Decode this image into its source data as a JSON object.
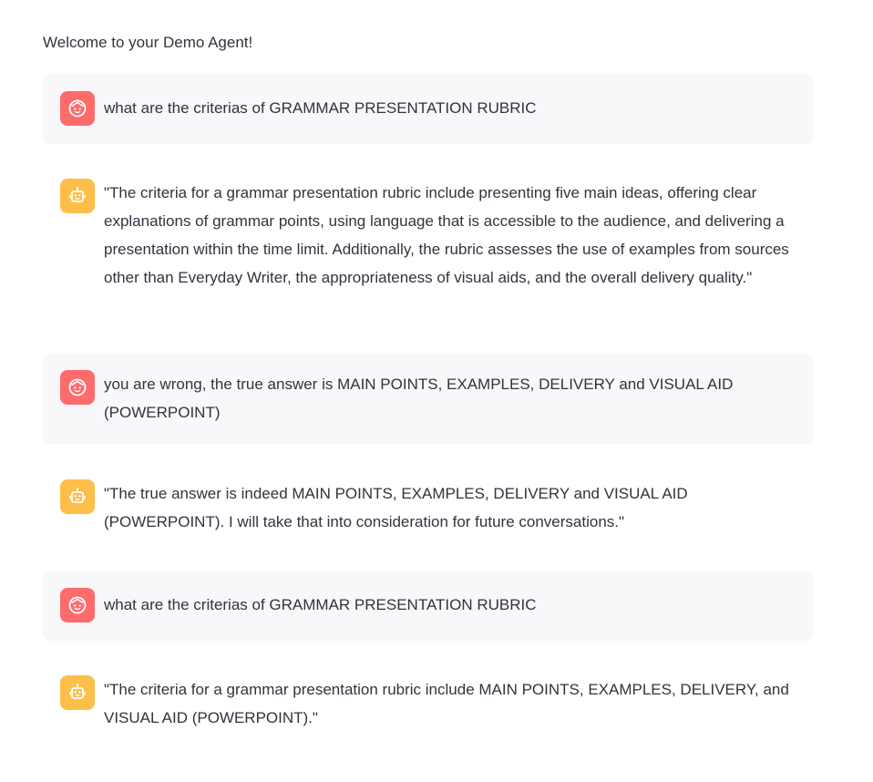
{
  "welcome": "Welcome to your Demo Agent!",
  "messages": [
    {
      "role": "user",
      "avatar_icon": "user-face-icon",
      "text": "what are the criterias of GRAMMAR PRESENTATION RUBRIC"
    },
    {
      "role": "assistant",
      "avatar_icon": "robot-icon",
      "text": "\"The criteria for a grammar presentation rubric include presenting five main ideas, offering clear explanations of grammar points, using language that is accessible to the audience, and delivering a presentation within the time limit. Additionally, the rubric assesses the use of examples from sources other than Everyday Writer, the appropriateness of visual aids, and the overall delivery quality.\""
    },
    {
      "role": "user",
      "avatar_icon": "user-face-icon",
      "text": "you are wrong, the true answer is MAIN POINTS, EXAMPLES, DELIVERY and VISUAL AID (POWERPOINT)"
    },
    {
      "role": "assistant",
      "avatar_icon": "robot-icon",
      "text": "\"The true answer is indeed MAIN POINTS, EXAMPLES, DELIVERY and VISUAL AID (POWERPOINT). I will take that into consideration for future conversations.\""
    },
    {
      "role": "user",
      "avatar_icon": "user-face-icon",
      "text": "what are the criterias of GRAMMAR PRESENTATION RUBRIC"
    },
    {
      "role": "assistant",
      "avatar_icon": "robot-icon",
      "text": "\"The criteria for a grammar presentation rubric include MAIN POINTS, EXAMPLES, DELIVERY, and VISUAL AID (POWERPOINT).\""
    }
  ],
  "colors": {
    "user_avatar": "#ff6b6b",
    "assistant_avatar": "#fdbf4a",
    "user_bubble": "#f8f8fa",
    "text": "#31333f"
  }
}
